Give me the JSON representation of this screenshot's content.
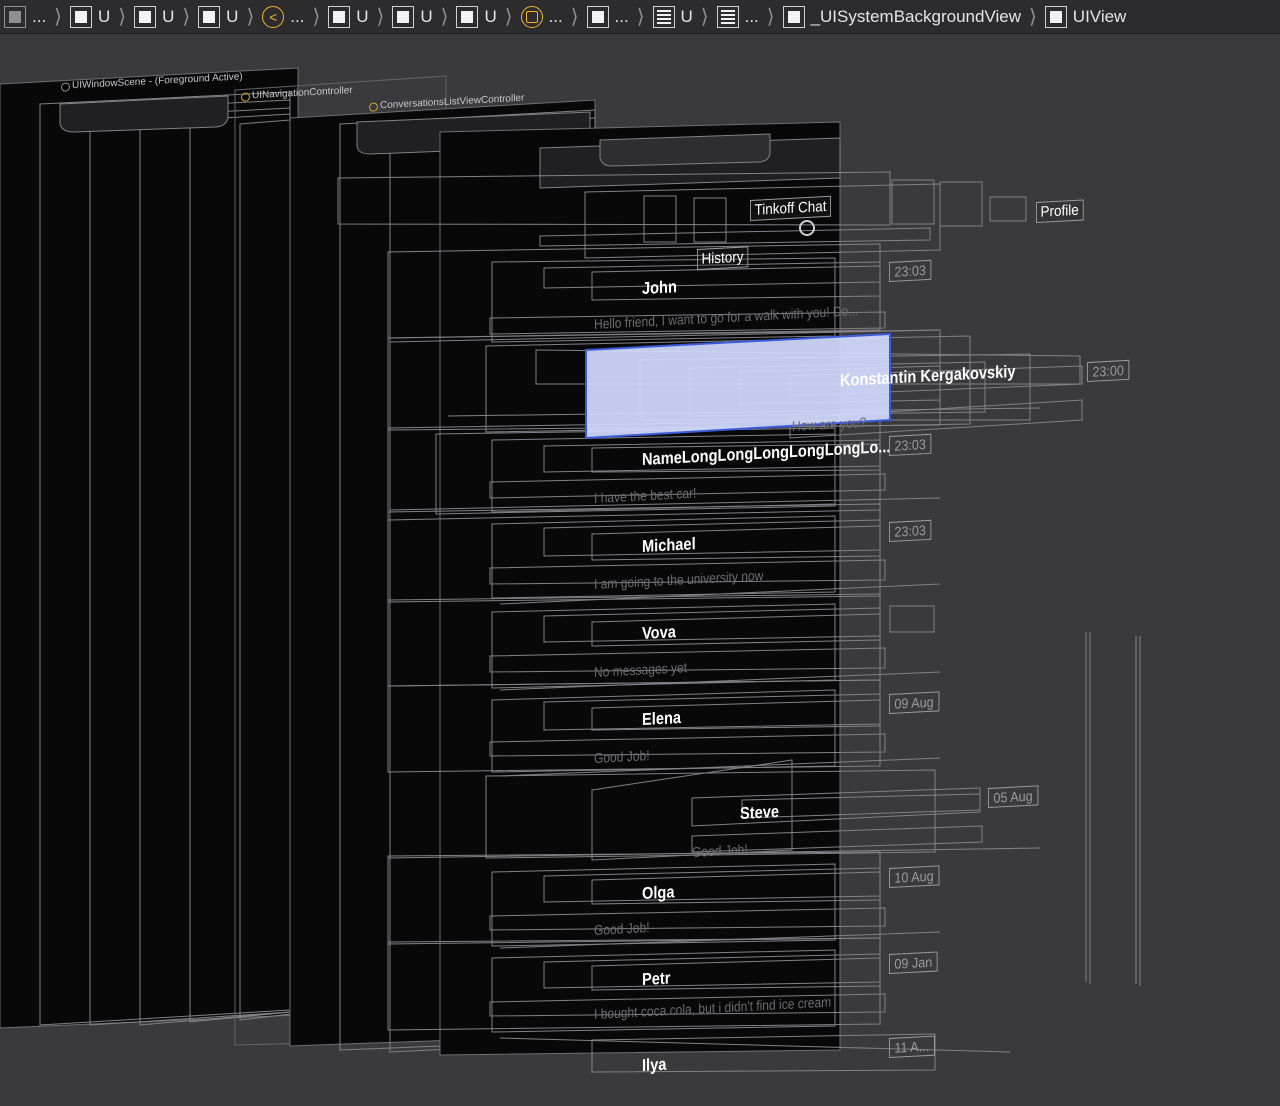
{
  "breadcrumb": {
    "items": [
      {
        "icon": "window-icon",
        "label": "..."
      },
      {
        "icon": "view-icon",
        "label": "U"
      },
      {
        "icon": "view-icon",
        "label": "U"
      },
      {
        "icon": "view-icon",
        "label": "U"
      },
      {
        "icon": "navigation-controller-icon",
        "label": "..."
      },
      {
        "icon": "view-icon",
        "label": "U"
      },
      {
        "icon": "view-icon",
        "label": "U"
      },
      {
        "icon": "view-icon",
        "label": "U"
      },
      {
        "icon": "view-controller-icon",
        "label": "..."
      },
      {
        "icon": "view-icon",
        "label": "..."
      },
      {
        "icon": "table-view-icon",
        "label": "U"
      },
      {
        "icon": "table-view-icon",
        "label": "..."
      },
      {
        "icon": "view-icon",
        "label": "_UISystemBackgroundView"
      },
      {
        "icon": "view-icon",
        "label": "UIView"
      }
    ]
  },
  "layers": {
    "window_scene": "UIWindowScene - (Foreground Active)",
    "navigation_controller": "UINavigationController",
    "conversations_vc": "ConversationsListViewController"
  },
  "navbar": {
    "title": "Tinkoff Chat",
    "profile": "Profile",
    "section": "History"
  },
  "conversations": [
    {
      "name": "John",
      "message": "Hello friend, I want to go for a walk with you! Do...",
      "time": "23:03"
    },
    {
      "name": "Konstantin Kergakovskiy",
      "message": "How are you?",
      "time": "23:00"
    },
    {
      "name": "NameLongLongLongLongLongLo...",
      "message": "I have the best car!",
      "time": "23:03"
    },
    {
      "name": "Michael",
      "message": "I am going to the university now",
      "time": "23:03"
    },
    {
      "name": "Vova",
      "message": "No messages yet",
      "time": ""
    },
    {
      "name": "Elena",
      "message": "Good Job!",
      "time": "09 Aug"
    },
    {
      "name": "Steve",
      "message": "Good Job!",
      "time": "05 Aug"
    },
    {
      "name": "Olga",
      "message": "Good Job!",
      "time": "10 Aug"
    },
    {
      "name": "Petr",
      "message": "I bought coca cola, but i didn't find ice cream",
      "time": "09 Jan"
    },
    {
      "name": "Ilya",
      "message": "",
      "time": "11 A..."
    }
  ],
  "colors": {
    "background": "#3a3a3c",
    "breadcrumb_bg": "#2c2c2e",
    "selection": "#d4dbff",
    "selection_border": "#3b5bdb",
    "wireframe": "#9a9aa0",
    "accent": "#f0b429"
  }
}
